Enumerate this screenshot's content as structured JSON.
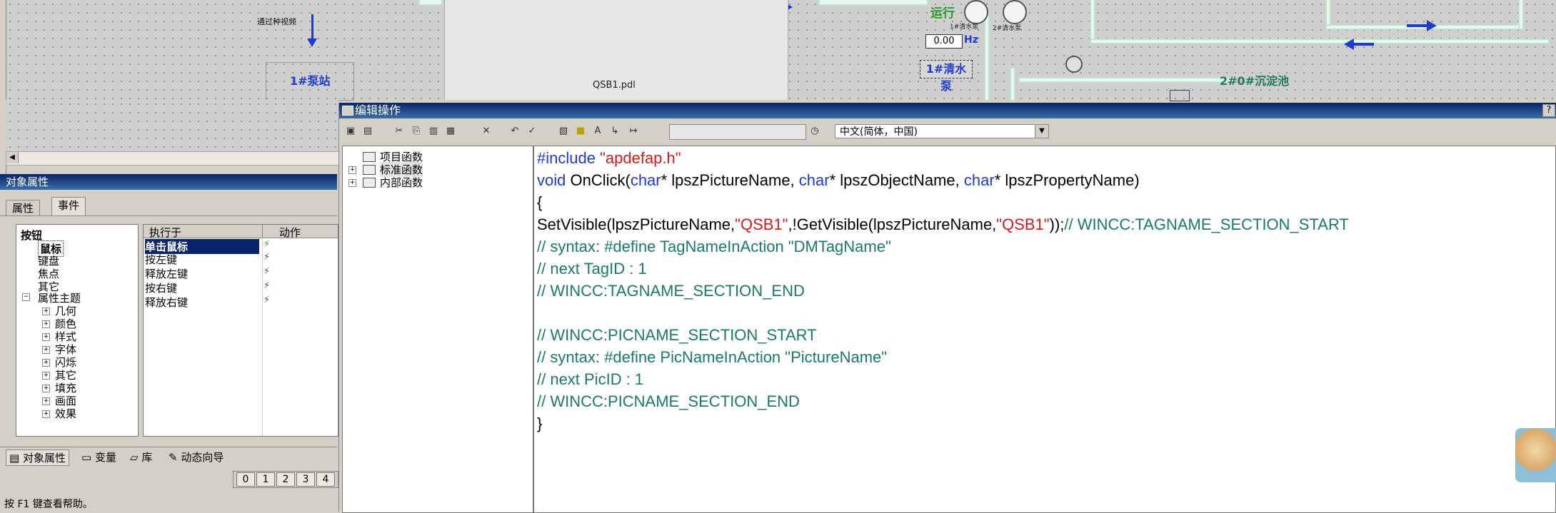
{
  "canvas": {
    "notice_label": "通过种视频",
    "station_label": "1#泵站",
    "qsb_label": "QSB1.pdl",
    "run_label": "运行",
    "pump1_caption": "1#清水泵",
    "pump2_caption": "2#清水泵",
    "frequency_value": "0.00",
    "frequency_unit": "Hz",
    "pump_button_label": "1#清水泵",
    "tank_label": "2#0#沉淀池"
  },
  "object_properties": {
    "title": "对象属性",
    "tabs": [
      "属性",
      "事件"
    ],
    "tree": [
      "按钮",
      "鼠标",
      "键盘",
      "焦点",
      "其它",
      "属性主题",
      "几何",
      "颜色",
      "样式",
      "字体",
      "闪烁",
      "其它",
      "填充",
      "画面",
      "效果"
    ],
    "grid_headers": {
      "exec": "执行于",
      "action": "动作"
    },
    "events": [
      "单击鼠标",
      "按左键",
      "释放左键",
      "按右键",
      "释放右键"
    ],
    "bottom_tabs": [
      "对象属性",
      "变量",
      "库",
      "动态向导"
    ],
    "levels": [
      "0",
      "1",
      "2",
      "3",
      "4"
    ],
    "status": "按 F1 键查看帮助。"
  },
  "dialog": {
    "title": "编辑操作",
    "help": "?",
    "language": "中文(简体，中国)",
    "function_tree": [
      "项目函数",
      "标准函数",
      "内部函数"
    ]
  },
  "code": {
    "line1": {
      "kw": "#include ",
      "str": "\"apdefap.h\""
    },
    "line2": {
      "a": "void",
      "b": " OnClick(",
      "c": "char",
      "d": "* lpszPictureName, ",
      "e": "char",
      "f": "* lpszObjectName, ",
      "g": "char",
      "h": "* lpszPropertyName)"
    },
    "line3": "{",
    "line4": {
      "a": "SetVisible(lpszPictureName,",
      "b": "\"QSB1\"",
      "c": ",!GetVisible(lpszPictureName,",
      "d": "\"QSB1\"",
      "e": "));",
      "f": "// WINCC:TAGNAME_SECTION_START"
    },
    "line5": "// syntax: #define TagNameInAction \"DMTagName\"",
    "line6": "// next TagID : 1",
    "line7": "// WINCC:TAGNAME_SECTION_END",
    "line8": "// WINCC:PICNAME_SECTION_START",
    "line9": "// syntax: #define PicNameInAction \"PictureName\"",
    "line10": "// next PicID : 1",
    "line11": "// WINCC:PICNAME_SECTION_END",
    "line12": "}"
  },
  "colors": {
    "title_bar": "#0a246a",
    "keyword": "#1e3ccf",
    "string": "#d41a1a",
    "comment": "#1a7a6a"
  }
}
